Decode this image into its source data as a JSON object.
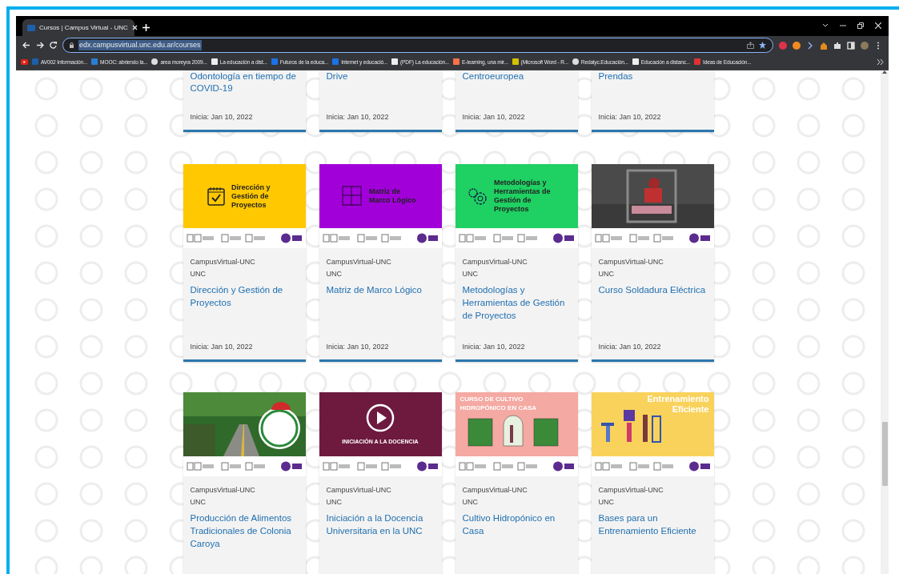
{
  "browser": {
    "tab_title": "Cursos | Campus Virtual - UNC",
    "url": "edx.campusvirtual.unc.edu.ar/courses",
    "url_selected": true,
    "bookmarks": [
      "AV002 Información...",
      "MOOC: abriendo la...",
      "area moreyra 2009...",
      "La educación a dist...",
      "Futuros de la educa...",
      "Internet y educació...",
      "(PDF) La educación...",
      "E-learning, una mir...",
      "(Microsoft Word - R...",
      "Redalyc.Educación...",
      "Educación a distanc...",
      "Ideas de Educación..."
    ]
  },
  "course_rows": [
    [
      {
        "title": "Odontología en tiempo de COVID-19",
        "start": "Inicia: Jan 10, 2022"
      },
      {
        "title": "Drive",
        "start": "Inicia: Jan 10, 2022"
      },
      {
        "title": "Centroeuropea",
        "start": "Inicia: Jan 10, 2022"
      },
      {
        "title": "Prendas",
        "start": "Inicia: Jan 10, 2022"
      }
    ],
    [
      {
        "banner": {
          "kind": "graphic",
          "text": "Dirección y Gestión de Proyectos",
          "color": "#ffc800"
        },
        "org": "CampusVirtual-UNC",
        "school": "UNC",
        "title": "Dirección y Gestión de Proyectos",
        "start": "Inicia: Jan 10, 2022"
      },
      {
        "banner": {
          "kind": "graphic",
          "text": "Matriz de Marco Lógico",
          "color": "#a100d9"
        },
        "org": "CampusVirtual-UNC",
        "school": "UNC",
        "title": "Matriz de Marco Lógico",
        "start": "Inicia: Jan 10, 2022"
      },
      {
        "banner": {
          "kind": "graphic",
          "text": "Metodologías y Herramientas de Gestión de Proyectos",
          "color": "#1fd062"
        },
        "org": "CampusVirtual-UNC",
        "school": "UNC",
        "title": "Metodologías y Herramientas de Gestión de Proyectos",
        "start": "Inicia: Jan 10, 2022"
      },
      {
        "org": "CampusVirtual-UNC",
        "school": "UNC",
        "title": "Curso Soldadura Eléctrica",
        "start": "Inicia: Jan 10, 2022"
      }
    ],
    [
      {
        "org": "CampusVirtual-UNC",
        "school": "UNC",
        "title": "Producción de Alimentos Tradicionales de Colonia Caroya"
      },
      {
        "banner": {
          "kind": "graphic",
          "text": "INICIACIÓN A LA DOCENCIA",
          "color": "#6e1a3f"
        },
        "org": "CampusVirtual-UNC",
        "school": "UNC",
        "title": "Iniciación a la Docencia Universitaria en la UNC"
      },
      {
        "banner": {
          "kind": "graphic",
          "text": "CURSO DE CULTIVO HIDROPÓNICO EN CASA",
          "color": "#f4a9a2"
        },
        "org": "CampusVirtual-UNC",
        "school": "UNC",
        "title": "Cultivo Hidropónico en Casa"
      },
      {
        "banner": {
          "kind": "graphic",
          "text": "Entrenamiento Eficiente",
          "color": "#f9d25c"
        },
        "org": "CampusVirtual-UNC",
        "school": "UNC",
        "title": "Bases para un Entrenamiento Eficiente"
      }
    ]
  ]
}
